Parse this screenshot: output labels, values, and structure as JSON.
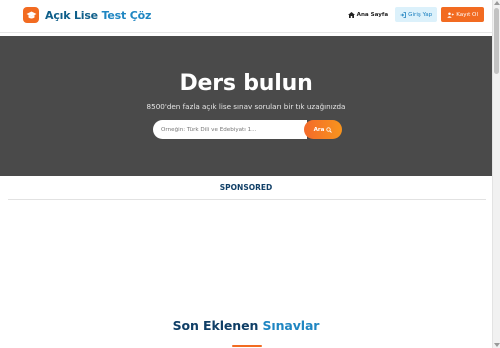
{
  "header": {
    "logo_text_primary": "Açık Lise",
    "logo_text_accent": "Test Çöz",
    "logo_icon": "graduation-cap-icon",
    "nav": {
      "home_label": "Ana Sayfa",
      "home_icon": "home-icon",
      "login_label": "Giriş Yap",
      "login_icon": "sign-in-icon",
      "register_label": "Kayıt Ol",
      "register_icon": "user-plus-icon"
    }
  },
  "hero": {
    "title": "Ders bulun",
    "subtitle": "8500'den fazla açık lise sınav soruları bir tık uzağınızda",
    "search": {
      "placeholder": "Örneğin: Türk Dili ve Edebiyatı 1...",
      "value": "",
      "button_label": "Ara",
      "button_icon": "search-icon"
    }
  },
  "sponsored": {
    "label": "SPONSORED"
  },
  "section": {
    "title_primary": "Son Eklenen",
    "title_accent": "Sınavlar"
  },
  "colors": {
    "brand_orange": "#f26b21",
    "brand_blue": "#1f86c2",
    "navy": "#0f3e66",
    "hero_bg": "#4a4a4a"
  }
}
